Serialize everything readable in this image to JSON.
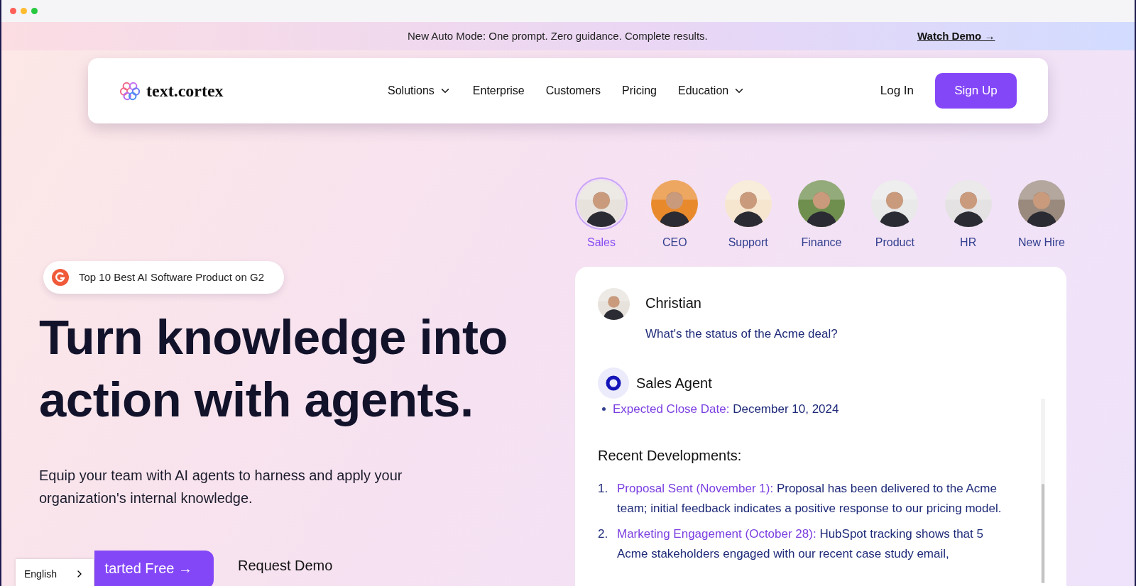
{
  "announcement": {
    "text": "New Auto Mode: One prompt. Zero guidance. Complete results.",
    "link": "Watch Demo →"
  },
  "nav": {
    "logo": "text.cortex",
    "items": [
      {
        "label": "Solutions",
        "dropdown": true
      },
      {
        "label": "Enterprise",
        "dropdown": false
      },
      {
        "label": "Customers",
        "dropdown": false
      },
      {
        "label": "Pricing",
        "dropdown": false
      },
      {
        "label": "Education",
        "dropdown": true
      }
    ],
    "login": "Log In",
    "signup": "Sign Up"
  },
  "hero": {
    "badge": "Top 10 Best AI Software Product on G2",
    "headline": [
      "Turn knowledge into",
      "action with agents."
    ],
    "subtitle": "Equip your team with AI agents to harness and apply your organization's internal knowledge.",
    "primary_button": "tarted Free →",
    "secondary_button": "Request Demo"
  },
  "roles": [
    {
      "label": "Sales",
      "selected": true,
      "color": "#e7e2dc"
    },
    {
      "label": "CEO",
      "selected": false,
      "color": "#e88a2c"
    },
    {
      "label": "Support",
      "selected": false,
      "color": "#f6e6cf"
    },
    {
      "label": "Finance",
      "selected": false,
      "color": "#6f8f4e"
    },
    {
      "label": "Product",
      "selected": false,
      "color": "#e9e9e9"
    },
    {
      "label": "HR",
      "selected": false,
      "color": "#e4e2e2"
    },
    {
      "label": "New Hire",
      "selected": false,
      "color": "#9a8a7e"
    }
  ],
  "chat": {
    "user": {
      "name": "Christian",
      "message": "What's the status of the Acme deal?"
    },
    "agent": {
      "name": "Sales Agent"
    },
    "bullets": [
      {
        "label": "Expected Close Date:",
        "text": "December 10, 2024"
      }
    ],
    "section_title": "Recent Developments:",
    "items": [
      {
        "number": "1.",
        "label": "Proposal Sent (November 1):",
        "text": "Proposal has been delivered to the Acme team; initial feedback indicates a positive response to our pricing model."
      },
      {
        "number": "2.",
        "label": "Marketing Engagement (October 28):",
        "text": "HubSpot tracking shows that 5 Acme stakeholders engaged with our recent case study email,"
      }
    ]
  },
  "language": {
    "label": "English"
  }
}
